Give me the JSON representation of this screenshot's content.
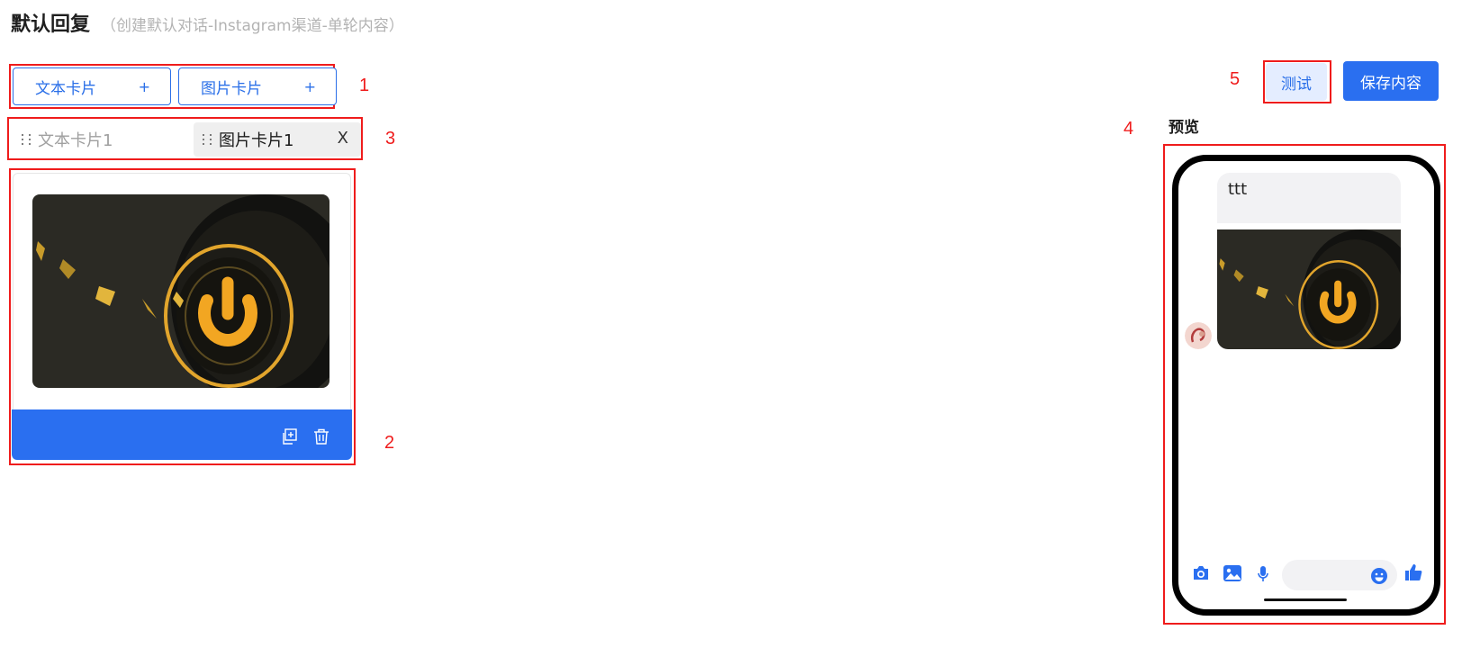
{
  "header": {
    "title": "默认回复",
    "subtitle": "（创建默认对话-Instagram渠道-单轮内容）"
  },
  "toolbar": {
    "add_text_card_label": "文本卡片",
    "add_image_card_label": "图片卡片",
    "plus_symbol": "+"
  },
  "tabs": [
    {
      "label": "文本卡片1",
      "active": false
    },
    {
      "label": "图片卡片1",
      "active": true
    }
  ],
  "tab_close_symbol": "X",
  "editor": {
    "icons": [
      "copy-icon",
      "trash-icon"
    ]
  },
  "actions": {
    "test_label": "测试",
    "save_label": "保存内容"
  },
  "preview": {
    "label": "预览",
    "message_text": "ttt",
    "input_placeholder": "",
    "icons": [
      "camera-icon",
      "gallery-icon",
      "microphone-icon",
      "emoji-icon",
      "thumbs-up-icon"
    ]
  },
  "annotations": [
    "1",
    "2",
    "3",
    "4",
    "5"
  ],
  "colors": {
    "accent": "#2a6ff0",
    "annotation_red": "#ef1c1c",
    "test_button_bg": "#e4edff"
  }
}
